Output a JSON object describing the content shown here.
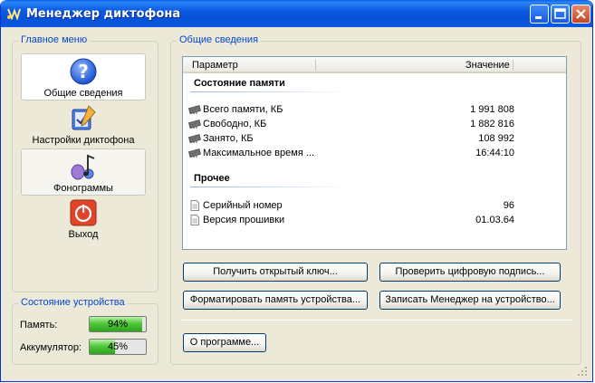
{
  "window": {
    "title": "Менеджер диктофона",
    "minimize_icon": "minimize-icon",
    "maximize_icon": "maximize-icon",
    "close_icon": "close-icon"
  },
  "main_menu": {
    "title": "Главное меню",
    "items": [
      {
        "label": "Общие сведения",
        "icon": "help-question-icon",
        "selected": true
      },
      {
        "label": "Настройки диктофона",
        "icon": "settings-pen-icon",
        "selected": false
      },
      {
        "label": "Фонограммы",
        "icon": "music-note-icon",
        "selected": false
      },
      {
        "label": "Выход",
        "icon": "power-exit-icon",
        "selected": false
      }
    ]
  },
  "device_status": {
    "title": "Состояние устройства",
    "memory": {
      "label": "Память:",
      "percent": 94,
      "text": "94%"
    },
    "battery": {
      "label": "Аккумулятор:",
      "percent": 45,
      "text": "45%"
    }
  },
  "general_info": {
    "title": "Общие сведения",
    "columns": {
      "param": "Параметр",
      "value": "Значение"
    },
    "groups": [
      {
        "name": "Состояние памяти",
        "rows": [
          {
            "name": "Всего памяти, КБ",
            "value": "1 991 808",
            "icon": "memory-chip-icon"
          },
          {
            "name": "Свободно, КБ",
            "value": "1 882 816",
            "icon": "memory-chip-icon"
          },
          {
            "name": "Занято, КБ",
            "value": "108 992",
            "icon": "memory-chip-icon"
          },
          {
            "name": "Максимальное время ...",
            "value": "16:44:10",
            "icon": "memory-chip-icon"
          }
        ]
      },
      {
        "name": "Прочее",
        "rows": [
          {
            "name": "Серийный номер",
            "value": "96",
            "icon": "document-icon"
          },
          {
            "name": "Версия прошивки",
            "value": "01.03.64",
            "icon": "document-icon"
          }
        ]
      }
    ],
    "buttons": {
      "get_key": "Получить открытый ключ...",
      "verify_signature": "Проверить цифровую подпись...",
      "format_memory": "Форматировать память устройства...",
      "write_manager": "Записать Менеджер на устройство...",
      "about": "О программе..."
    }
  },
  "colors": {
    "titlebar": "#0a5be1",
    "group_title": "#0046d5",
    "progress_fill": "#2ea41d"
  }
}
